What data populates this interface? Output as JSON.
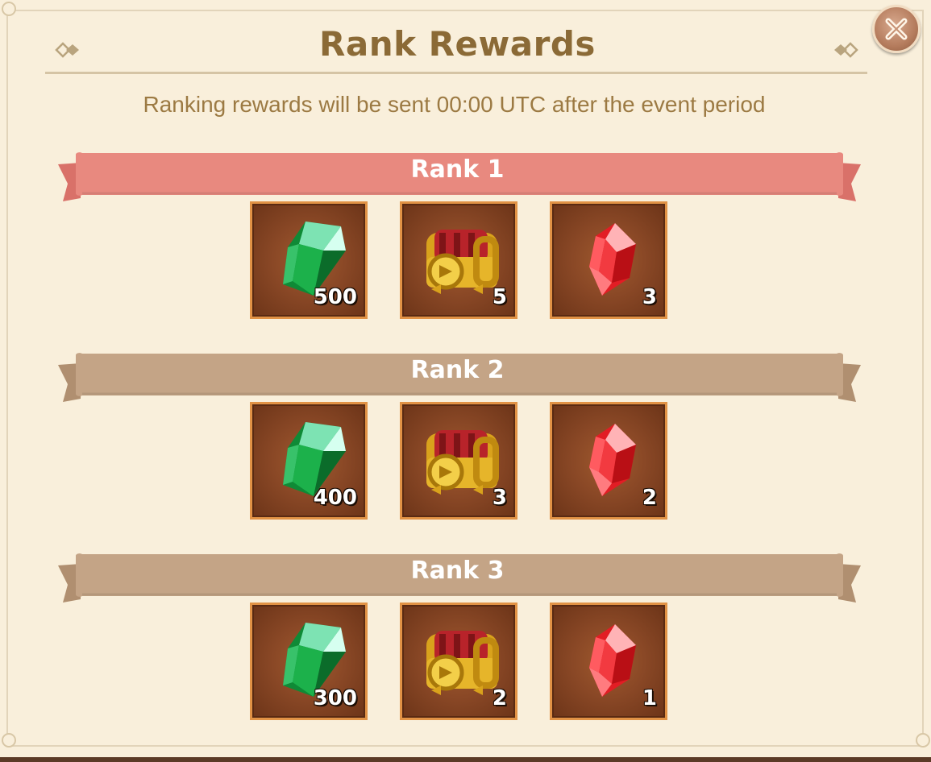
{
  "dialog": {
    "title": "Rank Rewards",
    "subtitle": "Ranking rewards will be sent 00:00 UTC after the event period",
    "close_icon": "close-icon"
  },
  "colors": {
    "panel_bg": "#f9efdb",
    "title": "#8b6a36",
    "rank1_banner": "#e8897f",
    "rank_banner": "#c4a486",
    "slot_border": "#e19245"
  },
  "ranks": [
    {
      "label": "Rank 1",
      "rewards": [
        {
          "icon": "green-gem-icon",
          "count": "500"
        },
        {
          "icon": "treasure-chest-icon",
          "count": "5"
        },
        {
          "icon": "red-crystal-icon",
          "count": "3"
        }
      ]
    },
    {
      "label": "Rank 2",
      "rewards": [
        {
          "icon": "green-gem-icon",
          "count": "400"
        },
        {
          "icon": "treasure-chest-icon",
          "count": "3"
        },
        {
          "icon": "red-crystal-icon",
          "count": "2"
        }
      ]
    },
    {
      "label": "Rank 3",
      "rewards": [
        {
          "icon": "green-gem-icon",
          "count": "300"
        },
        {
          "icon": "treasure-chest-icon",
          "count": "2"
        },
        {
          "icon": "red-crystal-icon",
          "count": "1"
        }
      ]
    }
  ]
}
